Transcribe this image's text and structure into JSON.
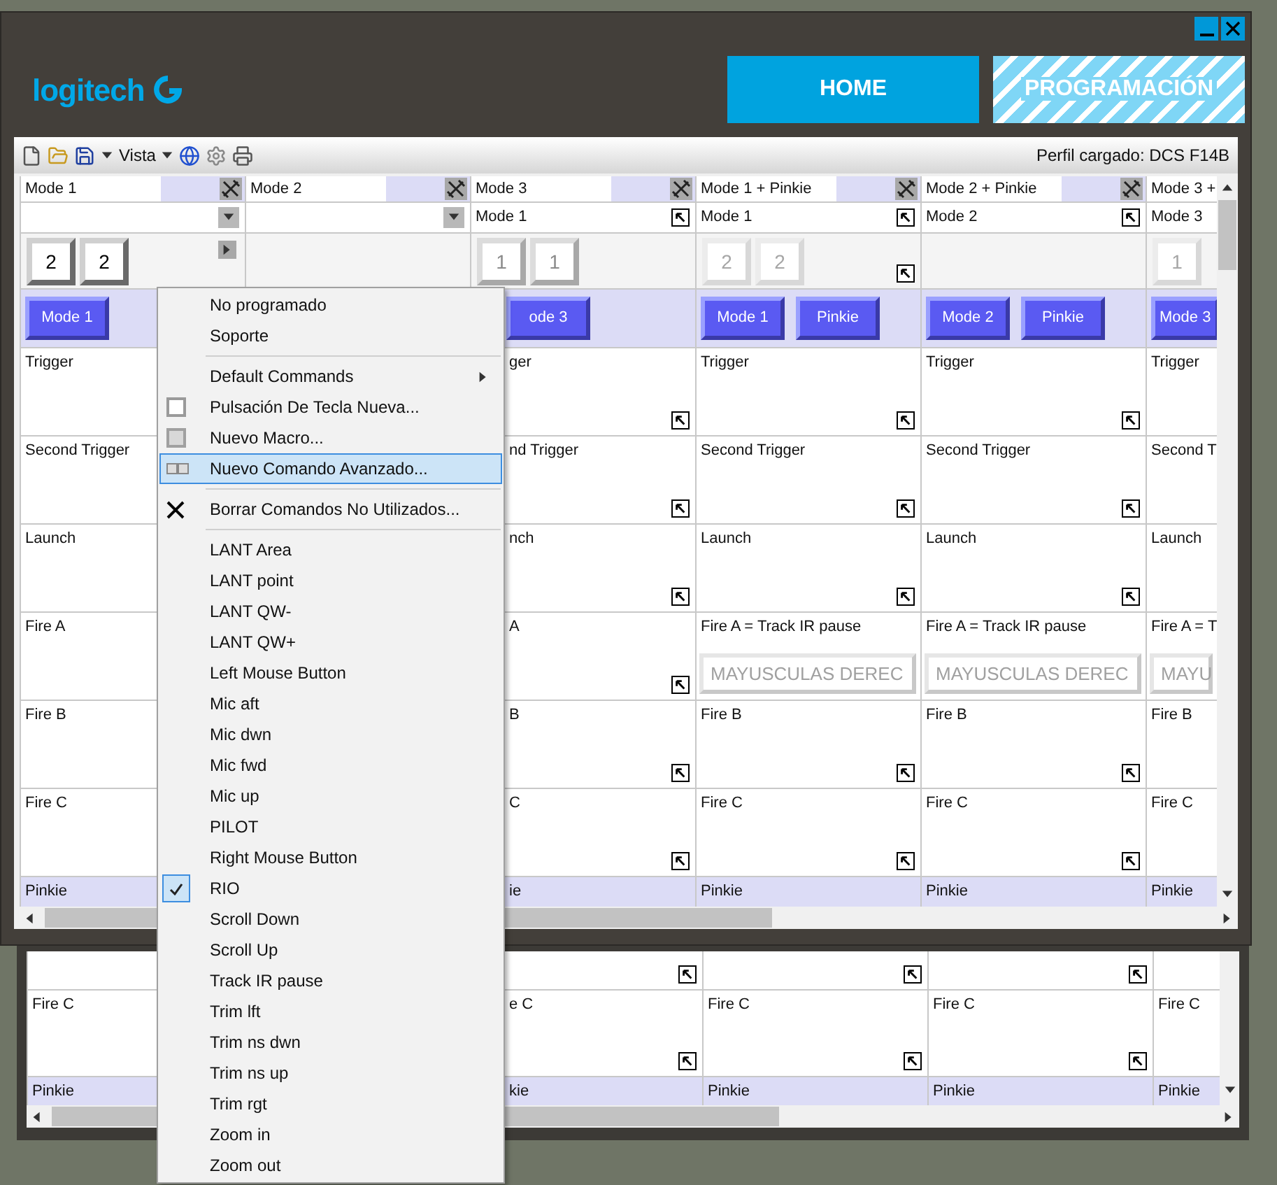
{
  "window": {
    "logo_text": "logitech",
    "nav": [
      {
        "label": "HOME",
        "selected": false
      },
      {
        "label": "PROGRAMACIÓN",
        "selected": true
      }
    ]
  },
  "toolbar": {
    "view_menu": "Vista",
    "profile": "Perfil cargado: DCS F14B"
  },
  "columns": [
    {
      "title": "Mode 1",
      "tools_icon": true,
      "selector": {
        "kind": "dropdown"
      },
      "keys": [
        {
          "label": "2",
          "kind": "own"
        },
        {
          "label": "2",
          "kind": "own"
        }
      ],
      "key_arrow": true,
      "mode_buttons": [
        "Mode 1"
      ],
      "cells": [
        {
          "label": "Trigger"
        },
        {
          "label": "Second Trigger"
        },
        {
          "label": "Launch"
        },
        {
          "label": "Fire A"
        },
        {
          "label": "Fire B"
        },
        {
          "label": "Fire C"
        }
      ],
      "footer": "Pinkie"
    },
    {
      "title": "Mode 2",
      "tools_icon": true,
      "selector": {
        "kind": "dropdown"
      }
    },
    {
      "title": "Mode 3",
      "tools_icon": true,
      "selector": {
        "kind": "linked",
        "value": "Mode 1",
        "icon": true
      },
      "keys": [
        {
          "label": "1",
          "kind": "inherited"
        },
        {
          "label": "1",
          "kind": "inherited"
        }
      ],
      "mode_buttons": [
        "ode 3"
      ],
      "cells": [
        {
          "label": "ger"
        },
        {
          "label": "nd Trigger"
        },
        {
          "label": "nch"
        },
        {
          "label": "A"
        },
        {
          "label": "B"
        },
        {
          "label": "C"
        }
      ],
      "cell_icons": true,
      "footer": "ie"
    },
    {
      "title": "Mode 1 + Pinkie",
      "tools_icon": true,
      "selector": {
        "kind": "linked",
        "value": "Mode 1",
        "icon": true
      },
      "keys": [
        {
          "label": "2",
          "kind": "disabled"
        },
        {
          "label": "2",
          "kind": "disabled"
        }
      ],
      "key_expand": true,
      "mode_buttons": [
        "Mode 1",
        "Pinkie"
      ],
      "cells": [
        {
          "label": "Trigger"
        },
        {
          "label": "Second Trigger"
        },
        {
          "label": "Launch"
        },
        {
          "label": "Fire A = Track IR pause",
          "field": "MAYUSCULAS DEREC"
        },
        {
          "label": "Fire B"
        },
        {
          "label": "Fire C"
        }
      ],
      "cell_icons": true,
      "footer": "Pinkie"
    },
    {
      "title": "Mode 2 + Pinkie",
      "tools_icon": true,
      "selector": {
        "kind": "linked",
        "value": "Mode 2",
        "icon": true
      },
      "mode_buttons": [
        "Mode 2",
        "Pinkie"
      ],
      "cells": [
        {
          "label": "Trigger"
        },
        {
          "label": "Second Trigger"
        },
        {
          "label": "Launch"
        },
        {
          "label": "Fire A = Track IR pause",
          "field": "MAYUSCULAS DEREC"
        },
        {
          "label": "Fire B"
        },
        {
          "label": "Fire C"
        }
      ],
      "cell_icons": true,
      "footer": "Pinkie"
    },
    {
      "title": "Mode 3 +",
      "selector": {
        "kind": "linked",
        "value": "Mode 3",
        "icon": false
      },
      "keys": [
        {
          "label": "1",
          "kind": "disabled"
        }
      ],
      "mode_buttons": [
        "Mode 3"
      ],
      "cells": [
        {
          "label": "Trigger"
        },
        {
          "label": "Second T"
        },
        {
          "label": "Launch"
        },
        {
          "label": "Fire A = T",
          "field": "MAYU"
        },
        {
          "label": "Fire B"
        },
        {
          "label": "Fire C"
        }
      ],
      "footer": "Pinkie"
    }
  ],
  "background_window": {
    "columns": [
      {
        "label": "Fire C",
        "footer": "Pinkie"
      },
      {},
      {
        "label": "e C",
        "footer": "kie",
        "icons": true
      },
      {
        "label": "Fire C",
        "footer": "Pinkie",
        "icons": true
      },
      {
        "label": "Fire C",
        "footer": "Pinkie",
        "icons": true
      },
      {
        "label": "Fire C",
        "footer": "Pinkie"
      }
    ]
  },
  "context_menu": {
    "items": [
      {
        "kind": "item",
        "label": "No programado",
        "selected": false,
        "checked": false
      },
      {
        "kind": "item",
        "label": "Soporte",
        "selected": false,
        "checked": false
      },
      {
        "kind": "separator"
      },
      {
        "kind": "submenu",
        "label": "Default Commands",
        "selected": false,
        "checked": false
      },
      {
        "kind": "keystroke",
        "label": "Pulsación De Tecla Nueva...",
        "selected": false,
        "checked": false
      },
      {
        "kind": "macro",
        "label": "Nuevo Macro...",
        "selected": false,
        "checked": false
      },
      {
        "kind": "advanced",
        "label": "Nuevo Comando Avanzado...",
        "selected": true,
        "checked": false
      },
      {
        "kind": "separator"
      },
      {
        "kind": "delete",
        "label": "Borrar Comandos No Utilizados...",
        "selected": false,
        "checked": false
      },
      {
        "kind": "separator"
      },
      {
        "kind": "item",
        "label": "LANT Area",
        "selected": false,
        "checked": false
      },
      {
        "kind": "item",
        "label": "LANT point",
        "selected": false,
        "checked": false
      },
      {
        "kind": "item",
        "label": "LANT QW-",
        "selected": false,
        "checked": false
      },
      {
        "kind": "item",
        "label": "LANT QW+",
        "selected": false,
        "checked": false
      },
      {
        "kind": "item",
        "label": "Left Mouse Button",
        "selected": false,
        "checked": false
      },
      {
        "kind": "item",
        "label": "Mic aft",
        "selected": false,
        "checked": false
      },
      {
        "kind": "item",
        "label": "Mic dwn",
        "selected": false,
        "checked": false
      },
      {
        "kind": "item",
        "label": "Mic fwd",
        "selected": false,
        "checked": false
      },
      {
        "kind": "item",
        "label": "Mic up",
        "selected": false,
        "checked": false
      },
      {
        "kind": "item",
        "label": "PILOT",
        "selected": false,
        "checked": false
      },
      {
        "kind": "item",
        "label": "Right Mouse Button",
        "selected": false,
        "checked": false
      },
      {
        "kind": "item",
        "label": "RIO",
        "selected": false,
        "checked": true
      },
      {
        "kind": "item",
        "label": "Scroll Down",
        "selected": false,
        "checked": false
      },
      {
        "kind": "item",
        "label": "Scroll Up",
        "selected": false,
        "checked": false
      },
      {
        "kind": "item",
        "label": "Track IR pause",
        "selected": false,
        "checked": false
      },
      {
        "kind": "item",
        "label": "Trim lft",
        "selected": false,
        "checked": false
      },
      {
        "kind": "item",
        "label": "Trim ns dwn",
        "selected": false,
        "checked": false
      },
      {
        "kind": "item",
        "label": "Trim ns up",
        "selected": false,
        "checked": false
      },
      {
        "kind": "item",
        "label": "Trim rgt",
        "selected": false,
        "checked": false
      },
      {
        "kind": "item",
        "label": "Zoom in",
        "selected": false,
        "checked": false
      },
      {
        "kind": "item",
        "label": "Zoom out",
        "selected": false,
        "checked": false
      }
    ]
  }
}
